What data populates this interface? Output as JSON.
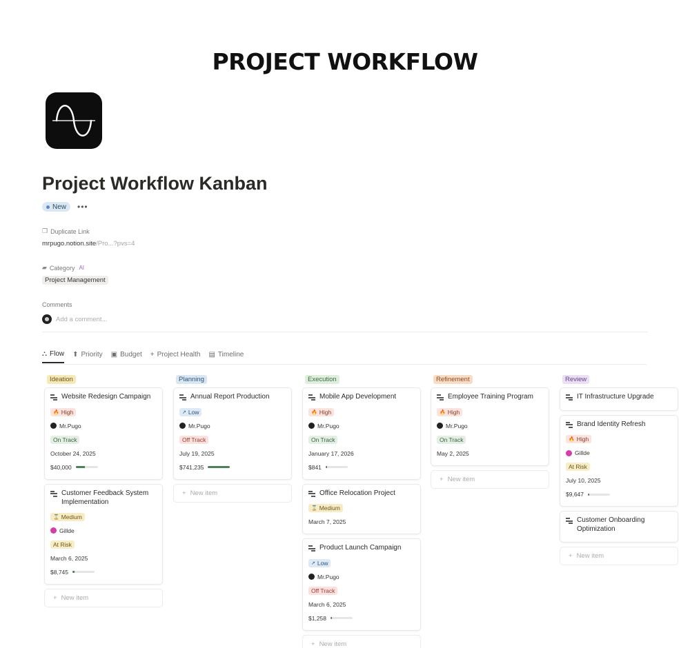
{
  "banner_title": "PROJECT WORKFLOW",
  "page": {
    "title": "Project Workflow Kanban",
    "status": "New",
    "more": "•••"
  },
  "properties": {
    "duplicate_link": {
      "label": "Duplicate Link",
      "value_main": "mrpugo.notion.site",
      "value_fade": "/Pro...?pvs=4"
    },
    "category": {
      "label": "Category",
      "ai_badge": "AI",
      "value": "Project Management"
    },
    "comments": {
      "label": "Comments",
      "placeholder": "Add a comment..."
    }
  },
  "tabs": [
    {
      "label": "Flow",
      "icon": "flow-icon"
    },
    {
      "label": "Priority",
      "icon": "arrow-up-icon"
    },
    {
      "label": "Budget",
      "icon": "money-icon"
    },
    {
      "label": "Project Health",
      "icon": "plus-icon"
    },
    {
      "label": "Timeline",
      "icon": "timeline-icon"
    }
  ],
  "new_item_label": "New item",
  "colors": {
    "ideation": "#f6e9b8",
    "planning": "#d9e7f3",
    "execution": "#dfeede",
    "refinement": "#f9dcc6",
    "review": "#ebdff4",
    "budget_bar": "#4b8159"
  },
  "columns": [
    {
      "name": "Ideation",
      "cards": [
        {
          "title": "Website Redesign Campaign",
          "priority": "High",
          "owner": "Mr.Pugo",
          "health": "On Track",
          "date": "October 24, 2025",
          "budget": "$40,000",
          "budget_fraction": 0.4
        },
        {
          "title": "Customer Feedback System Implementation",
          "priority": "Medium",
          "owner": "Gillde",
          "health": "At Risk",
          "date": "March 6, 2025",
          "budget": "$8,745",
          "budget_fraction": 0.08
        }
      ]
    },
    {
      "name": "Planning",
      "cards": [
        {
          "title": "Annual Report Production",
          "priority": "Low",
          "owner": "Mr.Pugo",
          "health": "Off Track",
          "date": "July 19, 2025",
          "budget": "$741,235",
          "budget_fraction": 1.0
        }
      ]
    },
    {
      "name": "Execution",
      "cards": [
        {
          "title": "Mobile App Development",
          "priority": "High",
          "owner": "Mr.Pugo",
          "health": "On Track",
          "date": "January 17, 2026",
          "budget": "$841",
          "budget_fraction": 0.0
        },
        {
          "title": "Office Relocation Project",
          "priority": "Medium",
          "date": "March 7, 2025"
        },
        {
          "title": "Product Launch Campaign",
          "priority": "Low",
          "owner": "Mr.Pugo",
          "health": "Off Track",
          "date": "March 6, 2025",
          "budget": "$1,258",
          "budget_fraction": 0.02
        }
      ]
    },
    {
      "name": "Refinement",
      "cards": [
        {
          "title": "Employee Training Program",
          "priority": "High",
          "owner": "Mr.Pugo",
          "health": "On Track",
          "date": "May 2, 2025"
        }
      ]
    },
    {
      "name": "Review",
      "cards": [
        {
          "title": "IT Infrastructure Upgrade"
        },
        {
          "title": "Brand Identity Refresh",
          "priority": "High",
          "owner": "Gillde",
          "health": "At Risk",
          "date": "July 10, 2025",
          "budget": "$9,647",
          "budget_fraction": 0.05
        },
        {
          "title": "Customer Onboarding Optimization"
        }
      ]
    }
  ]
}
